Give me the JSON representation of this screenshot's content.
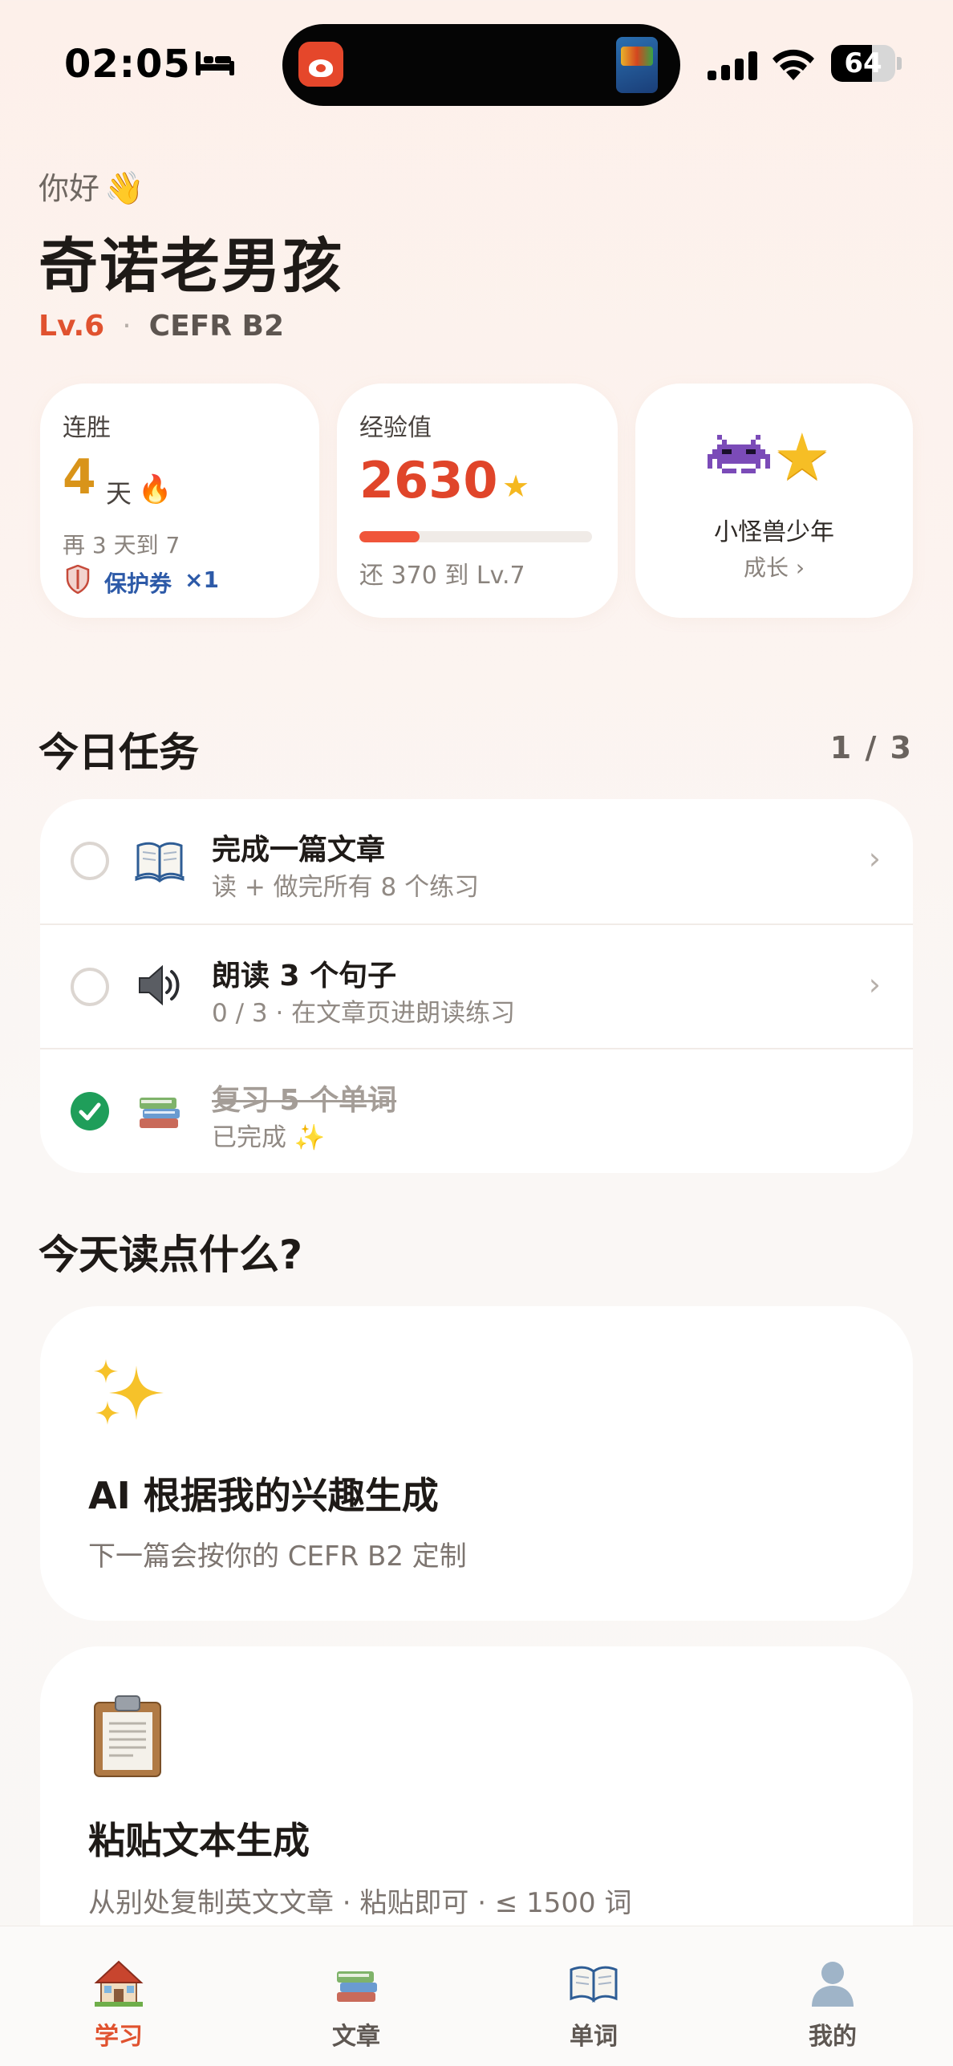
{
  "status_bar": {
    "time": "02:05",
    "battery": "64",
    "battery_level": 0.64
  },
  "header": {
    "greeting": "你好",
    "username": "奇诺老男孩",
    "level": "Lv.6",
    "separator": "·",
    "cefr": "CEFR B2"
  },
  "stats": {
    "streak": {
      "label": "连胜",
      "value": "4",
      "unit": "天",
      "sub": "再 3 天到 7",
      "coupon_label": "保护券",
      "coupon_count": "×1"
    },
    "xp": {
      "label": "经验值",
      "value": "2630",
      "progress": 0.26,
      "sub": "还 370 到 Lv.7"
    },
    "title": {
      "name": "小怪兽少年",
      "growth": "成长 ›"
    }
  },
  "tasks": {
    "heading": "今日任务",
    "count": "1 / 3",
    "items": [
      {
        "title": "完成一篇文章",
        "sub": "读 + 做完所有 8 个练习",
        "done": false,
        "icon": "book-icon"
      },
      {
        "title": "朗读 3 个句子",
        "sub": "0 / 3 · 在文章页进朗读练习",
        "done": false,
        "icon": "speaker-icon"
      },
      {
        "title": "复习 5 个单词",
        "sub": "已完成 ✨",
        "done": true,
        "icon": "books-icon"
      }
    ],
    "chevron": "›"
  },
  "read": {
    "heading": "今天读点什么?",
    "cards": [
      {
        "title": "AI 根据我的兴趣生成",
        "sub": "下一篇会按你的 CEFR B2 定制",
        "icon": "sparkles-icon"
      },
      {
        "title": "粘贴文本生成",
        "sub": "从别处复制英文文章 · 粘贴即可 · ≤ 1500 词",
        "icon": "clipboard-icon"
      }
    ]
  },
  "tab_bar": {
    "tabs": [
      {
        "label": "学习",
        "icon": "house-icon",
        "active": true
      },
      {
        "label": "文章",
        "icon": "books-icon",
        "active": false
      },
      {
        "label": "单词",
        "icon": "open-book-icon",
        "active": false
      },
      {
        "label": "我的",
        "icon": "person-icon",
        "active": false
      }
    ]
  },
  "colors": {
    "accent": "#e0522f",
    "streak": "#d9941a",
    "coupon": "#2d5aa8",
    "done": "#1f9e5a"
  }
}
